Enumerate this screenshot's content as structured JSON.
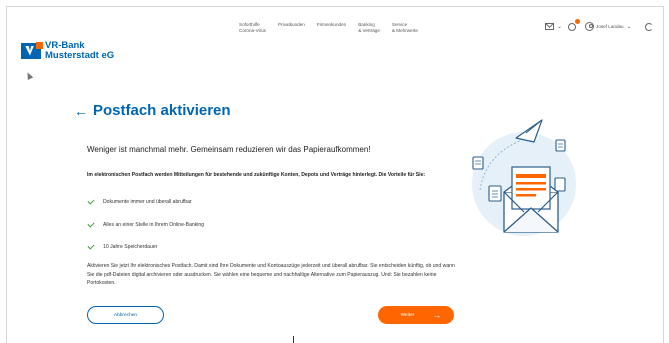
{
  "bank": {
    "name_line1": "VR-Bank",
    "name_line2": "Musterstadt eG"
  },
  "nav": [
    {
      "line1": "Soforthilfe",
      "line2": "Corona-Virus"
    },
    {
      "line1": "Privatkunden",
      "line2": ""
    },
    {
      "line1": "Firmenkunden",
      "line2": ""
    },
    {
      "line1": "Banking",
      "line2": "& Verträge"
    },
    {
      "line1": "Service",
      "line2": "& Mehrwerte"
    }
  ],
  "user": {
    "name": "Josef Landau"
  },
  "page": {
    "title": "Postfach aktivieren",
    "subtitle": "Weniger ist manchmal mehr. Gemeinsam reduzieren wir das Papieraufkommen!",
    "intro": "Im elektronischen Postfach werden Mitteilungen für bestehende und zukünftige Konten, Depots und Verträge hinterlegt. Die Vorteile für Sie:",
    "benefits": [
      "Dokumente immer und überall abrufbar",
      "Alles an einer Stelle in Ihrem Online-Banking",
      "10 Jahre Speicherdauer"
    ],
    "body": "Aktivieren Sie jetzt Ihr elektronisches Postfach. Damit sind Ihre Dokumente und Kontoauszüge jederzeit und überall abrufbar. Sie entscheiden künftig, ob und wann Sie die pdf-Dateien digital archivieren oder ausdrucken. Sie wählen eine bequeme und nachhaltige Alternative zum Papierauszug. Und: Sie bezahlen keine Portokosten."
  },
  "buttons": {
    "cancel": "Abbrechen",
    "next": "Weiter"
  },
  "colors": {
    "brand_blue": "#0066b3",
    "accent_orange": "#ff6600",
    "check_green": "#3a9d3a",
    "illustration_bg": "#e6f0f9"
  },
  "icons": [
    "mail-icon",
    "gear-icon",
    "user-icon",
    "logout-icon",
    "back-arrow-icon",
    "check-icon",
    "arrow-right-icon",
    "envelope-illustration",
    "paper-plane-icon"
  ]
}
